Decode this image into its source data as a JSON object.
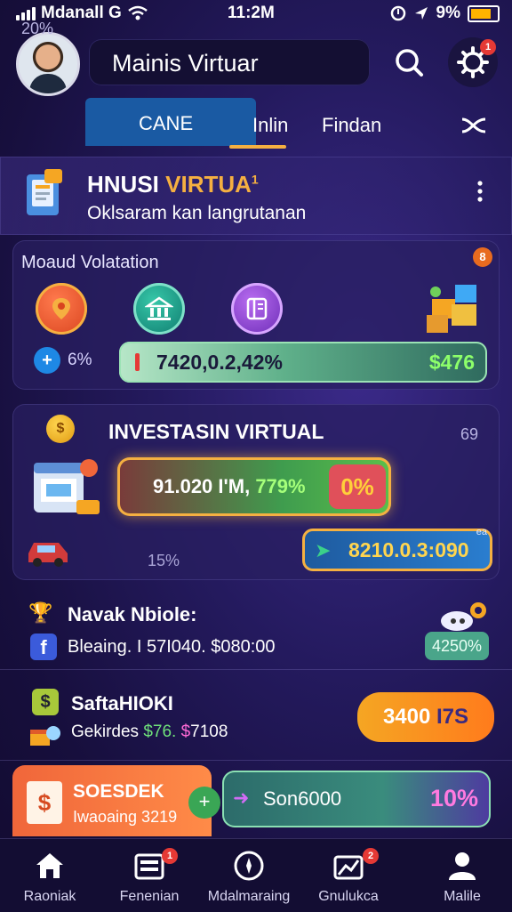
{
  "status": {
    "carrier": "Mdanall G",
    "time": "11:2M",
    "battery": "9%"
  },
  "header": {
    "title": "Mainis Virtuar",
    "notif_badge": "1"
  },
  "tabs": {
    "left_pct": "20%",
    "items": [
      "CANE",
      "Inlin",
      "Findan"
    ]
  },
  "hero": {
    "title_white": "HNUSI",
    "title_yellow": "VIRTUA",
    "title_sup": "1",
    "subtitle": "Oklsaram kan langrutanan"
  },
  "volatility": {
    "title": "Moaud Volatation",
    "badge": "8",
    "small_pct": "6%",
    "bar_value": "7420,0.2,42%",
    "bar_amount": "$476"
  },
  "investasi": {
    "title": "INVESTASIN VIRTUAL",
    "top_right": "69",
    "bar_value_white": "91.020 I'M,",
    "bar_value_green": "779%",
    "bar_pct": "0%",
    "pct_label": "15%",
    "bar2_value": "8210.0.3:090",
    "bar2_tag": "ea"
  },
  "row_navak": {
    "title": "Navak Nbiole:",
    "sub": "Bleaing. I 57I040. $080:00",
    "pill": "4250%"
  },
  "row_safta": {
    "title": "SaftaHIOKI",
    "sub_prefix": "Gekirdes",
    "sub_green": "$76.",
    "sub_magenta": "$",
    "sub_rest": "7108",
    "button_main": "3400",
    "button_accent": "I7S"
  },
  "bottom_cards": {
    "left_title": "SOESDEK",
    "left_sub": "Iwaoaing 3219",
    "right_title": "Son6000",
    "right_pct": "10%"
  },
  "nav": {
    "items": [
      {
        "label": "Raoniak",
        "icon": "home-icon",
        "badge": ""
      },
      {
        "label": "Fenenian",
        "icon": "wallet-icon",
        "badge": "1"
      },
      {
        "label": "Mdalmaraing",
        "icon": "compass-icon",
        "badge": ""
      },
      {
        "label": "Gnulukca",
        "icon": "chart-icon",
        "badge": "2"
      },
      {
        "label": "Malile",
        "icon": "profile-icon",
        "badge": ""
      }
    ]
  },
  "colors": {
    "accent": "#f5b041",
    "tab_active": "#1a5aa3",
    "bg": "#241a5e"
  }
}
